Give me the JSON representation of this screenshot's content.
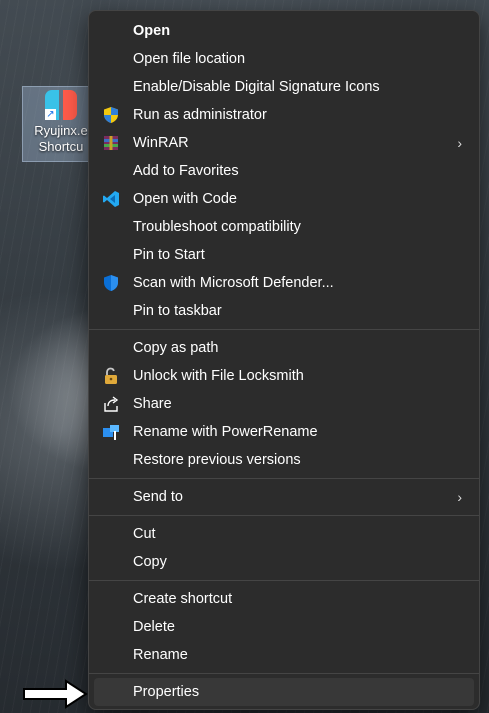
{
  "desktop": {
    "shortcut_line1": "Ryujinx.e",
    "shortcut_line2": "Shortcu"
  },
  "menu": {
    "open": "Open",
    "open_file_location": "Open file location",
    "digital_signature": "Enable/Disable Digital Signature Icons",
    "run_as_admin": "Run as administrator",
    "winrar": "WinRAR",
    "add_favorites": "Add to Favorites",
    "open_with_code": "Open with Code",
    "troubleshoot": "Troubleshoot compatibility",
    "pin_start": "Pin to Start",
    "scan_defender": "Scan with Microsoft Defender...",
    "pin_taskbar": "Pin to taskbar",
    "copy_as_path": "Copy as path",
    "unlock_locksmith": "Unlock with File Locksmith",
    "share": "Share",
    "power_rename": "Rename with PowerRename",
    "restore_versions": "Restore previous versions",
    "send_to": "Send to",
    "cut": "Cut",
    "copy": "Copy",
    "create_shortcut": "Create shortcut",
    "delete": "Delete",
    "rename": "Rename",
    "properties": "Properties",
    "submenu_chevron": "›"
  },
  "icons": {
    "run_as_admin": "uac-shield-icon",
    "winrar": "winrar-icon",
    "open_with_code": "vscode-icon",
    "scan_defender": "defender-shield-icon",
    "unlock_locksmith": "padlock-icon",
    "share": "share-icon",
    "power_rename": "powerrename-icon",
    "pointer": "white-arrow-icon"
  },
  "colors": {
    "menu_bg": "#2c2c2c",
    "hover_bg": "#383838",
    "text": "#ffffff",
    "separator": "#454545",
    "vscode_blue": "#23a9f2",
    "defender_blue": "#0a6fd6"
  }
}
